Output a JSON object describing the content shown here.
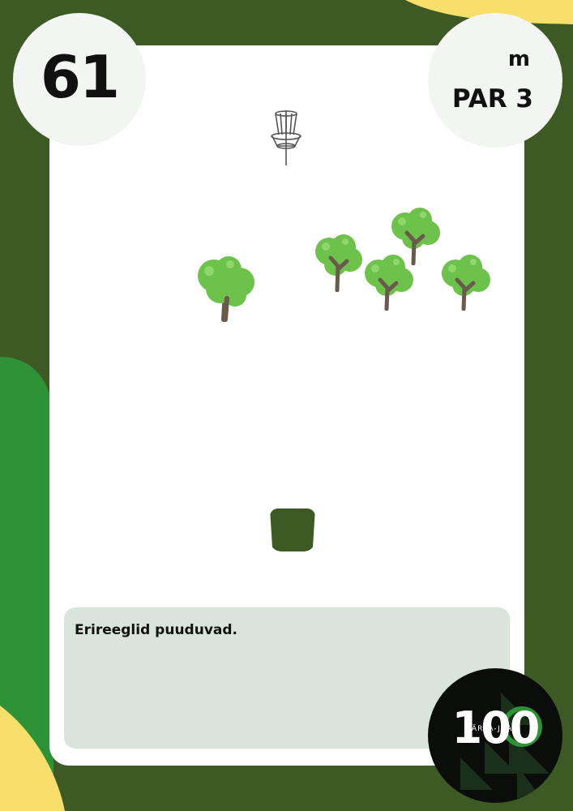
{
  "hole": {
    "number": "61"
  },
  "info": {
    "distance_unit": "m",
    "par": "PAR 3"
  },
  "rules": {
    "text": "Erireeglid puuduvad."
  },
  "logo": {
    "number": "100",
    "name": "JÄRVA-JAANI"
  },
  "colors": {
    "dark_green": "#3e5a24",
    "bright_green": "#2e9236",
    "yellow": "#f8df6b",
    "card": "#ffffff",
    "rules_box": "#d9e4dc",
    "tree_leaves": "#6cc24a",
    "tree_trunk": "#6b5a4c"
  },
  "icons": {
    "basket": "disc-golf-basket-icon",
    "tree": "tree-icon",
    "tee": "tee-pad-icon"
  }
}
